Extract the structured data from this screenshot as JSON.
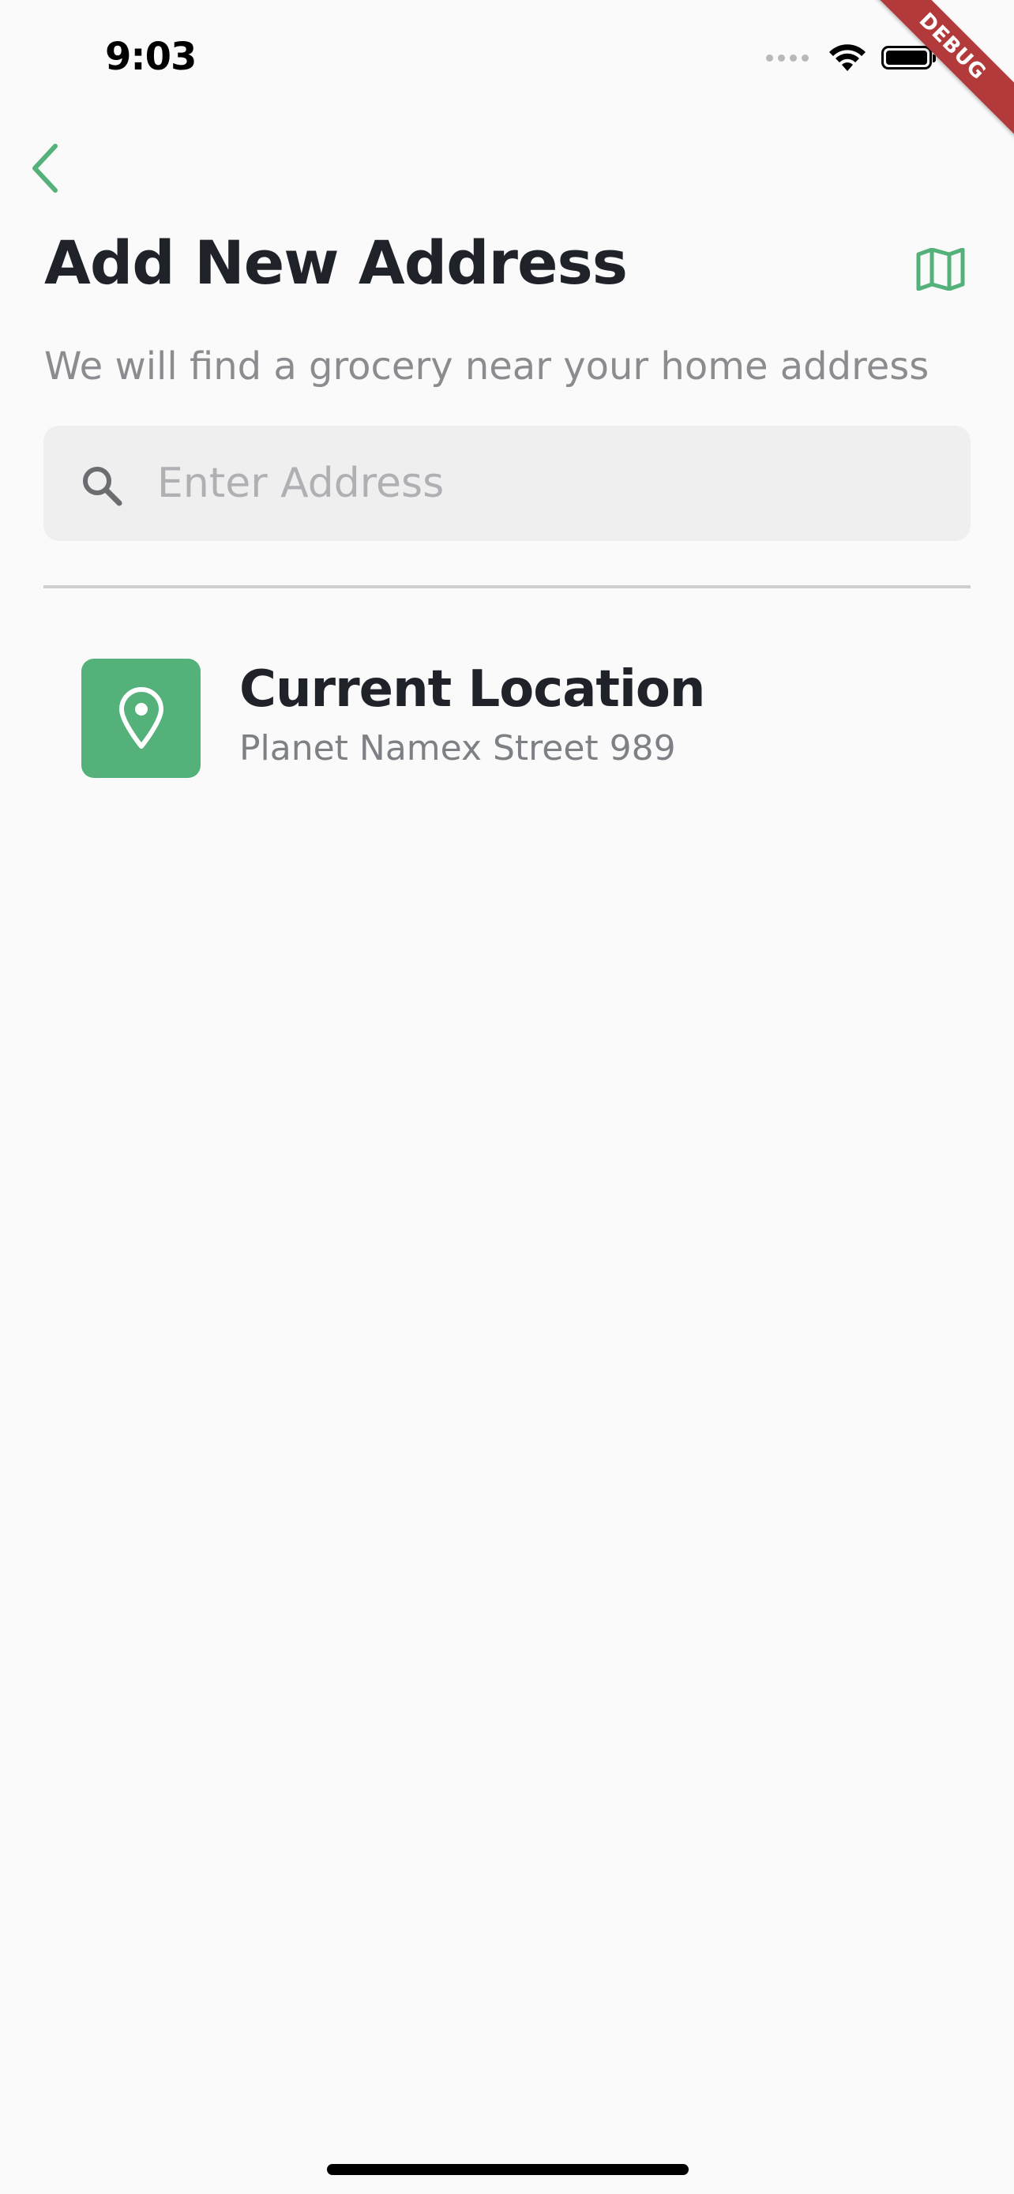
{
  "status_bar": {
    "time": "9:03"
  },
  "debug_banner": {
    "label": "DEBUG"
  },
  "header": {
    "title": "Add New Address",
    "subtitle": "We will find a grocery near your home address",
    "back_icon": "chevron-left-icon",
    "map_icon": "map-icon"
  },
  "search": {
    "placeholder": "Enter Address",
    "value": "",
    "icon": "search-icon"
  },
  "location_options": [
    {
      "title": "Current Location",
      "address": "Planet Namex Street 989",
      "icon": "location-pin-icon"
    }
  ],
  "colors": {
    "accent": "#55b17a",
    "title_text": "#1f2329",
    "subtitle_text": "#8a8c8f",
    "background": "#fafafa",
    "search_background": "#efefef",
    "debug_banner": "#b33a3a"
  }
}
